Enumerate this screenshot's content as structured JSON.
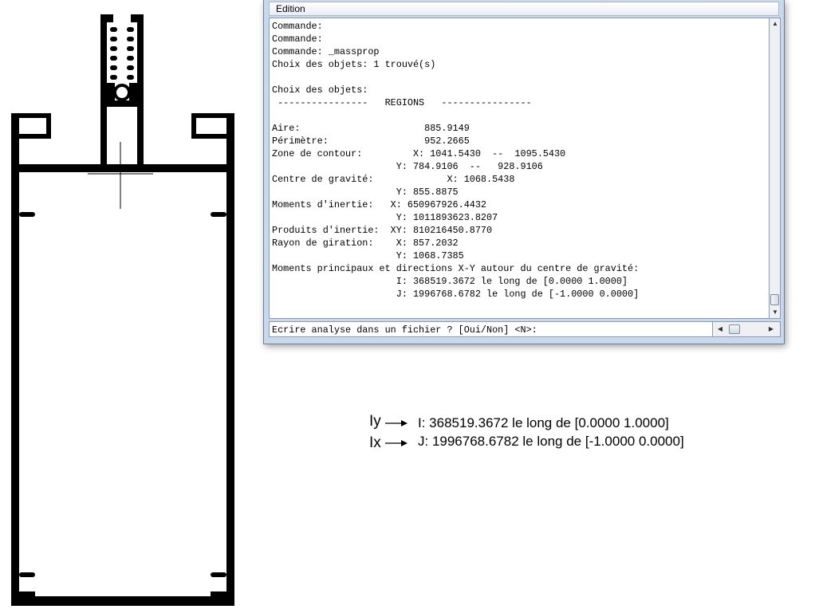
{
  "window": {
    "menu": "Edition",
    "history_lines": [
      "Commande:",
      "Commande:",
      "Commande: _massprop",
      "Choix des objets: 1 trouvé(s)",
      "",
      "Choix des objets:",
      " ----------------   REGIONS   ----------------",
      "",
      "Aire:                      885.9149",
      "Périmètre:                 952.2665",
      "Zone de contour:         X: 1041.5430  --  1095.5430",
      "                      Y: 784.9106  --   928.9106",
      "Centre de gravité:             X: 1068.5438",
      "                      Y: 855.8875",
      "Moments d'inertie:   X: 650967926.4432",
      "                      Y: 1011893623.8207",
      "Produits d'inertie:  XY: 810216450.8770",
      "Rayon de giration:    X: 857.2032",
      "                      Y: 1068.7385",
      "Moments principaux et directions X-Y autour du centre de gravité:",
      "                      I: 368519.3672 le long de [0.0000 1.0000]",
      "                      J: 1996768.6782 le long de [-1.0000 0.0000]"
    ],
    "command_prompt": "Ecrire analyse dans un fichier ? [Oui/Non] <N>:"
  },
  "annotation": {
    "rows": [
      {
        "label": "Iy",
        "text": "I: 368519.3672 le long de [0.0000 1.0000]"
      },
      {
        "label": "Ix",
        "text": "J: 1996768.6782 le long de [-1.0000 0.0000]"
      }
    ]
  },
  "colors": {
    "drawing": "#000000",
    "window_frame": "#c9d8ea"
  },
  "icons": {
    "up": "scroll-up-icon",
    "down": "scroll-down-icon",
    "left": "scroll-left-icon",
    "right": "scroll-right-icon",
    "crosshair": "crosshair-cursor-icon"
  }
}
